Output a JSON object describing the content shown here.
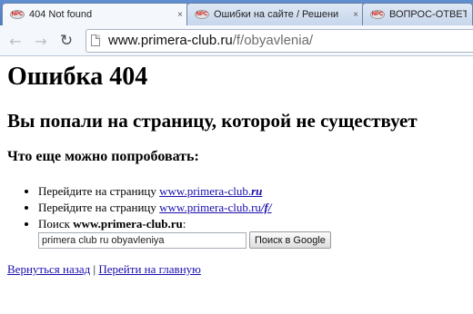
{
  "browser": {
    "tabs": [
      {
        "title": "404 Not found",
        "favicon": "NPC",
        "close": "×",
        "active": true
      },
      {
        "title": "Ошибки на сайте / Решени",
        "favicon": "NPC",
        "close": "×",
        "active": false
      },
      {
        "title": "ВОПРОС-ОТВЕТ от",
        "favicon": "NPC",
        "close": "",
        "active": false
      }
    ],
    "nav": {
      "back_icon": "←",
      "forward_icon": "→",
      "reload_icon": "↻"
    },
    "address": {
      "host": "www.primera-club.ru",
      "path": "/f/obyavlenia/"
    }
  },
  "page": {
    "heading": "Ошибка 404",
    "subheading": "Вы попали на страницу, которой не существует",
    "suggest_heading": "Что еще можно попробовать:",
    "items": [
      {
        "prefix": "Перейдите на страницу ",
        "link_text": "www.primera-club.",
        "link_strong": "ru"
      },
      {
        "prefix": "Перейдите на страницу ",
        "link_text": "www.primera-club.ru",
        "link_strong": "/f/"
      },
      {
        "prefix": "Поиск ",
        "site": "www.primera-club.ru",
        "suffix": ":"
      }
    ],
    "search": {
      "value": "primera club ru obyavleniya",
      "button_label": "Поиск в Google"
    },
    "links": {
      "back": "Вернуться назад",
      "separator": " | ",
      "home": "Перейти на главную"
    }
  }
}
